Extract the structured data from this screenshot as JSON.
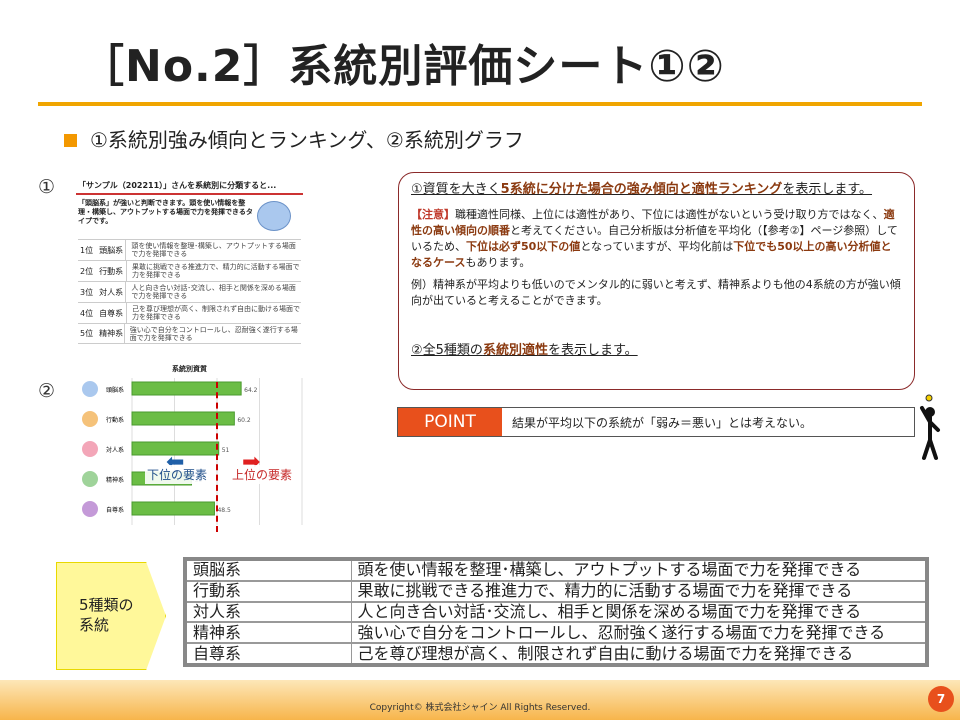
{
  "header": {
    "title": "［No.2］系統別評価シート①②"
  },
  "subheading": "①系統別強み傾向とランキング、②系統別グラフ",
  "markers": {
    "one": "①",
    "two": "②"
  },
  "thumb1": {
    "heading": "「サンプル（202211）」さんを系統別に分類すると...",
    "summary": "「頭脳系」が強いと判断できます。頭を使い情報を整理・構築し、アウトプットする場面で力を発揮できるタイプです。",
    "ranks": [
      {
        "rank": "1位",
        "name": "頭脳系",
        "desc": "頭を使い情報を整理･構築し、アウトプットする場面で力を発揮できる"
      },
      {
        "rank": "2位",
        "name": "行動系",
        "desc": "果敢に挑戦できる推進力で、精力的に活動する場面で力を発揮できる"
      },
      {
        "rank": "3位",
        "name": "対人系",
        "desc": "人と向き合い対話･交流し、相手と関係を深める場面で力を発揮できる"
      },
      {
        "rank": "4位",
        "name": "自尊系",
        "desc": "己を尊び理想が高く、制限されず自由に動ける場面で力を発揮できる"
      },
      {
        "rank": "5位",
        "name": "精神系",
        "desc": "強い心で自分をコントロールし、忍耐強く遂行する場面で力を発揮できる"
      }
    ]
  },
  "thumb2": {
    "chart_title": "系統別資質",
    "low_label": "下位の要素",
    "high_label": "上位の要素"
  },
  "chart_data": {
    "type": "bar",
    "title": "系統別資質",
    "categories": [
      "頭脳系",
      "行動系",
      "対人系",
      "精神系",
      "自尊系"
    ],
    "values": [
      64.2,
      60.2,
      51,
      35,
      48.5
    ],
    "value_labels": [
      "64.2",
      "60.2",
      "51",
      "35",
      "48.5"
    ],
    "xlim": [
      0,
      100
    ],
    "average": 50,
    "bar_color": "#6bbd45"
  },
  "explain": {
    "p1_pre": "①資質を大きく",
    "p1_em": "5系統に分けた場合の強み傾向と適性ランキング",
    "p1_post": "を表示します。",
    "note_tag": "【注意】",
    "note_a": "職種適性同様、上位には適性があり、下位には適性がないという受け取り方ではなく、",
    "note_em1": "適性の高い傾向の順番",
    "note_b": "と考えてください。自己分析版は分析値を平均化（【参考②】ページ参照）しているため、",
    "note_em2": "下位は必ず50以下の値",
    "note_c": "となっていますが、平均化前は",
    "note_em3": "下位でも50以上の高い分析値となるケース",
    "note_d": "もあります。",
    "example": "例）精神系が平均よりも低いのでメンタル的に弱いと考えず、精神系よりも他の4系統の方が強い傾向が出ていると考えることができます。",
    "p4_pre": "②全5種類の",
    "p4_em": "系統別適性",
    "p4_post": "を表示します。"
  },
  "point": {
    "tag": "POINT",
    "text": "結果が平均以下の系統が「弱み＝悪い」とは考えない。"
  },
  "types_tag": "5種類の\n系統",
  "types": [
    {
      "name": "頭脳系",
      "desc": "頭を使い情報を整理･構築し、アウトプットする場面で力を発揮できる"
    },
    {
      "name": "行動系",
      "desc": "果敢に挑戦できる推進力で、精力的に活動する場面で力を発揮できる"
    },
    {
      "name": "対人系",
      "desc": "人と向き合い対話･交流し、相手と関係を深める場面で力を発揮できる"
    },
    {
      "name": "精神系",
      "desc": "強い心で自分をコントロールし、忍耐強く遂行する場面で力を発揮できる"
    },
    {
      "name": "自尊系",
      "desc": "己を尊び理想が高く、制限されず自由に動ける場面で力を発揮できる"
    }
  ],
  "footer": {
    "copyright": "Copyright© 株式会社シャイン All Rights Reserved.",
    "page": "7"
  },
  "colors": {
    "accent": "#f39800",
    "point": "#e8501c",
    "emphasis": "#8b3a10",
    "box_border": "#8b2a2a"
  }
}
